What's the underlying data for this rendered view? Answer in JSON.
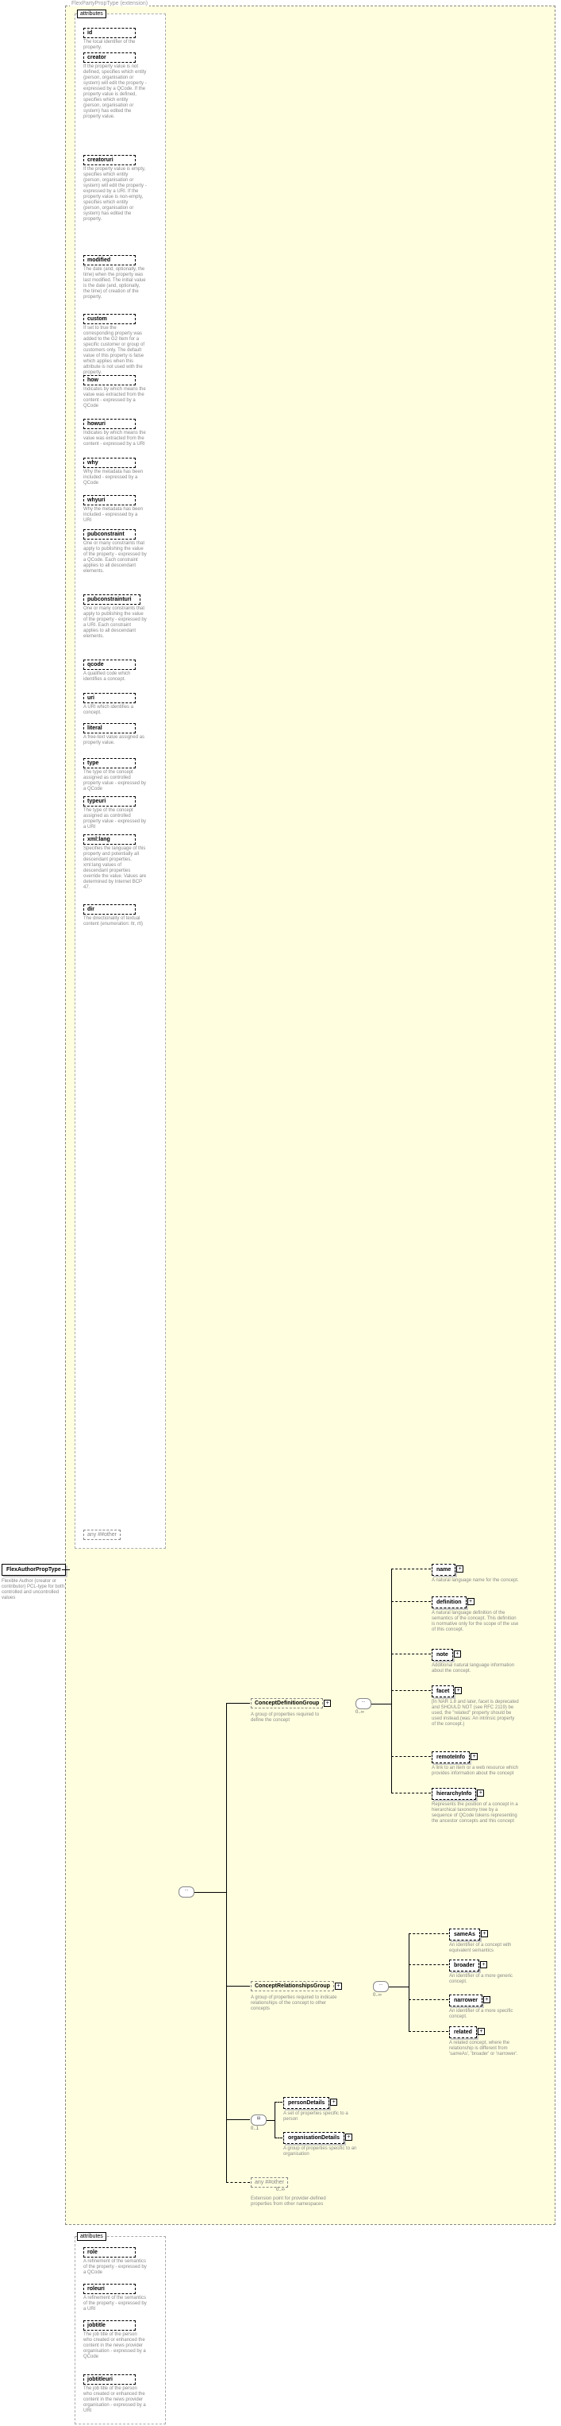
{
  "chart_data": {
    "type": "diagram",
    "root": {
      "name": "FlexAuthorPropType",
      "desc": "Flexible Author (creator or contributor) PCL-type for both controlled and uncontrolled values"
    },
    "extension": {
      "label": "FlexPartyPropType (extension)",
      "attributes_header": "attributes",
      "attributes": [
        {
          "name": "id",
          "desc": "The local identifier of the property."
        },
        {
          "name": "creator",
          "desc": "If the property value is not defined, specifies which entity (person, organisation or system) will edit the property - expressed by a QCode. If the property value is defined, specifies which entity (person, organisation or system) has edited the property value."
        },
        {
          "name": "creatoruri",
          "desc": "If the property value is empty, specifies which entity (person, organisation or system) will edit the property - expressed by a URI. If the property value is non-empty, specifies which entity (person, organisation or system) has edited the property."
        },
        {
          "name": "modified",
          "desc": "The date (and, optionally, the time) when the property was last modified. The initial value is the date (and, optionally, the time) of creation of the property."
        },
        {
          "name": "custom",
          "desc": "If set to true the corresponding property was added to the G2 Item for a specific customer or group of customers only. The default value of this property is false which applies when this attribute is not used with the property."
        },
        {
          "name": "how",
          "desc": "Indicates by which means the value was extracted from the content - expressed by a QCode"
        },
        {
          "name": "howuri",
          "desc": "Indicates by which means the value was extracted from the content - expressed by a URI"
        },
        {
          "name": "why",
          "desc": "Why the metadata has been included - expressed by a QCode"
        },
        {
          "name": "whyuri",
          "desc": "Why the metadata has been included - expressed by a URI"
        },
        {
          "name": "pubconstraint",
          "desc": "One or many constraints that apply to publishing the value of the property - expressed by a QCode. Each constraint applies to all descendant elements."
        },
        {
          "name": "pubconstrainturi",
          "desc": "One or many constraints that apply to publishing the value of the property - expressed by a URI. Each constraint applies to all descendant elements."
        },
        {
          "name": "qcode",
          "desc": "A qualified code which identifies a concept."
        },
        {
          "name": "uri",
          "desc": "A URI which identifies a concept."
        },
        {
          "name": "literal",
          "desc": "A free-text value assigned as property value."
        },
        {
          "name": "type",
          "desc": "The type of the concept assigned as controlled property value - expressed by a QCode"
        },
        {
          "name": "typeuri",
          "desc": "The type of the concept assigned as controlled property value - expressed by a URI"
        },
        {
          "name": "xml:lang",
          "desc": "Specifies the language of this property and potentially all descendant properties. xml:lang values of descendant properties override the value. Values are determined by Internet BCP 47."
        },
        {
          "name": "dir",
          "desc": "The directionality of textual content (enumeration: ltr, rtl)"
        }
      ],
      "any_attr": "##other",
      "groups": {
        "conceptDefinition": {
          "name": "ConceptDefinitionGroup",
          "desc": "A group of properties required to define the concept",
          "children": [
            {
              "name": "name",
              "desc": "A natural language name for the concept."
            },
            {
              "name": "definition",
              "desc": "A natural language definition of the semantics of the concept. This definition is normative only for the scope of the use of this concept."
            },
            {
              "name": "note",
              "desc": "Additional natural language information about the concept."
            },
            {
              "name": "facet",
              "desc": "[In NAR 1.8 and later, facet is deprecated and SHOULD NOT (see RFC 2119) be used, the \"related\" property should be used instead.(was: An intrinsic property of the concept.)"
            },
            {
              "name": "remoteInfo",
              "desc": "A link to an item or a web resource which provides information about the concept"
            },
            {
              "name": "hierarchyInfo",
              "desc": "Represents the position of a concept in a hierarchical taxonomy tree by a sequence of QCode tokens representing the ancestor concepts and this concept"
            }
          ]
        },
        "conceptRelationships": {
          "name": "ConceptRelationshipsGroup",
          "desc": "A group of properties required to indicate relationships of the concept to other concepts",
          "children": [
            {
              "name": "sameAs",
              "desc": "An identifier of a concept with equivalent semantics"
            },
            {
              "name": "broader",
              "desc": "An identifier of a more generic concept."
            },
            {
              "name": "narrower",
              "desc": "An identifier of a more specific concept."
            },
            {
              "name": "related",
              "desc": "A related concept, where the relationship is different from 'sameAs', 'broader' or 'narrower'."
            }
          ]
        },
        "detailsChoice": [
          {
            "name": "personDetails",
            "desc": "A set of properties specific to a person"
          },
          {
            "name": "organisationDetails",
            "desc": "A group of properties specific to an organisation"
          }
        ],
        "any": {
          "label": "##other",
          "desc": "Extension point for provider-defined properties from other namespaces"
        }
      }
    },
    "local_attrs": {
      "header": "attributes",
      "attributes": [
        {
          "name": "role",
          "desc": "A refinement of the semantics of the property - expressed by a QCode"
        },
        {
          "name": "roleuri",
          "desc": "A refinement of the semantics of the property - expressed by a URI"
        },
        {
          "name": "jobtitle",
          "desc": "The job title of the person who created or enhanced the content in the news provider organisation - expressed by a QCode"
        },
        {
          "name": "jobtitleuri",
          "desc": "The job title of the person who created or enhanced the content in the news provider organisation - expressed by a URI"
        }
      ]
    }
  },
  "occurs": {
    "zero_inf": "0..∞",
    "zero_one": "0..1"
  },
  "any_label": "any"
}
